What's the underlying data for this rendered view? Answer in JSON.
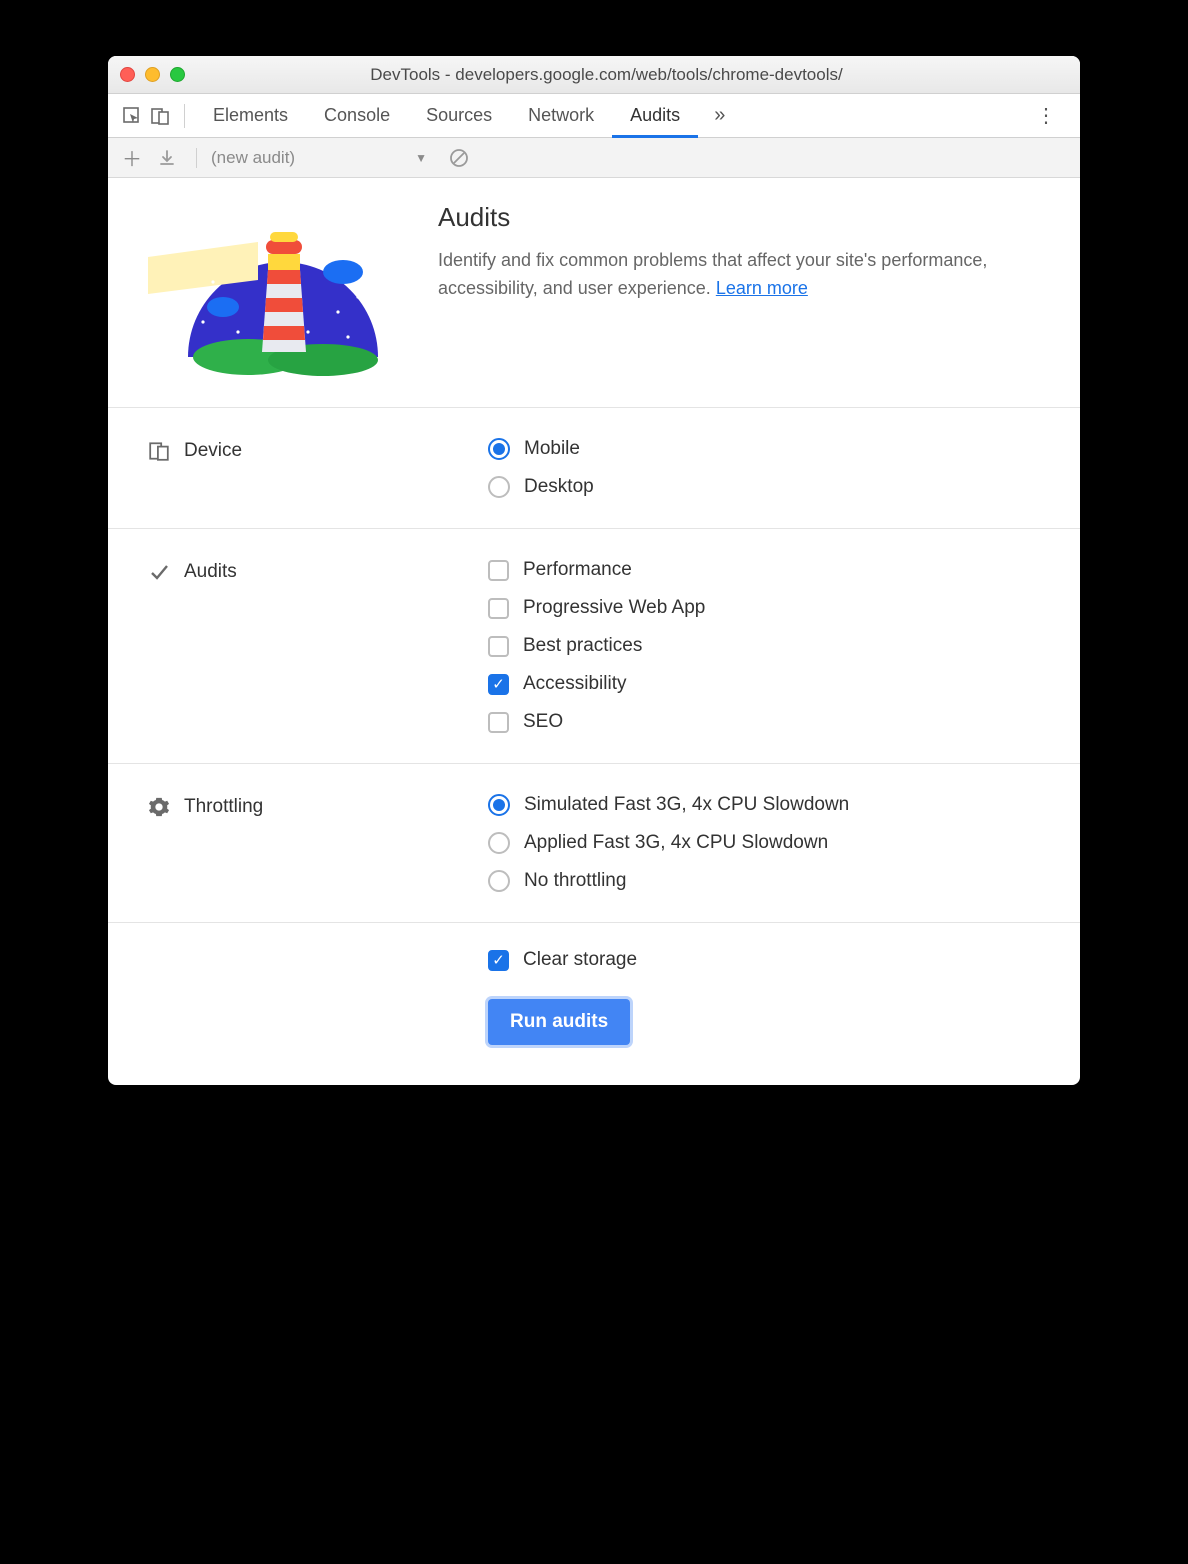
{
  "window": {
    "title": "DevTools - developers.google.com/web/tools/chrome-devtools/"
  },
  "tabs": {
    "items": [
      "Elements",
      "Console",
      "Sources",
      "Network",
      "Audits"
    ],
    "active": "Audits"
  },
  "subbar": {
    "audit_select": "(new audit)"
  },
  "intro": {
    "heading": "Audits",
    "body": "Identify and fix common problems that affect your site's performance, accessibility, and user experience. ",
    "link_text": "Learn more"
  },
  "sections": {
    "device": {
      "label": "Device",
      "options": [
        {
          "label": "Mobile",
          "checked": true
        },
        {
          "label": "Desktop",
          "checked": false
        }
      ]
    },
    "audits": {
      "label": "Audits",
      "options": [
        {
          "label": "Performance",
          "checked": false
        },
        {
          "label": "Progressive Web App",
          "checked": false
        },
        {
          "label": "Best practices",
          "checked": false
        },
        {
          "label": "Accessibility",
          "checked": true
        },
        {
          "label": "SEO",
          "checked": false
        }
      ]
    },
    "throttling": {
      "label": "Throttling",
      "options": [
        {
          "label": "Simulated Fast 3G, 4x CPU Slowdown",
          "checked": true
        },
        {
          "label": "Applied Fast 3G, 4x CPU Slowdown",
          "checked": false
        },
        {
          "label": "No throttling",
          "checked": false
        }
      ]
    },
    "storage": {
      "clear_label": "Clear storage",
      "clear_checked": true
    }
  },
  "run_button": "Run audits"
}
